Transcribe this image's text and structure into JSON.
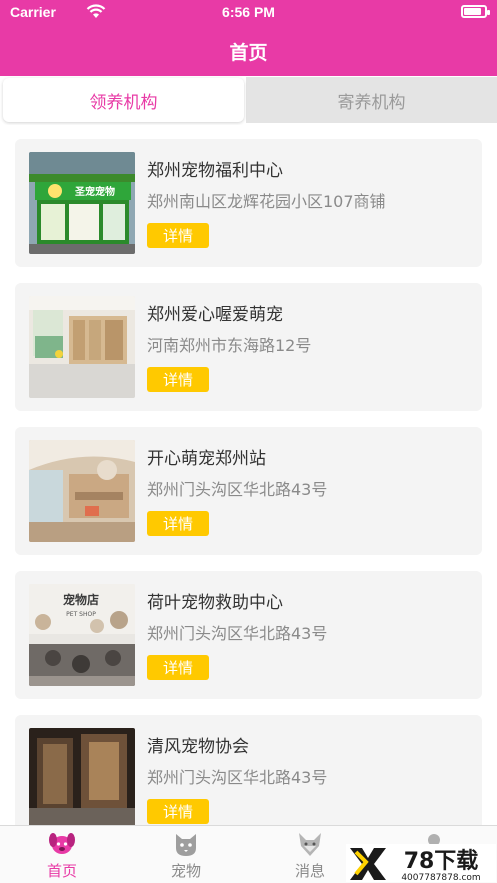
{
  "status_bar": {
    "carrier": "Carrier",
    "time": "6:56 PM",
    "battery_level": 0.85
  },
  "nav": {
    "title": "首页"
  },
  "segments": [
    {
      "label": "领养机构",
      "selected": true
    },
    {
      "label": "寄养机构",
      "selected": false
    }
  ],
  "organizations": [
    {
      "name": "郑州宠物福利中心",
      "address": "郑州南山区龙辉花园小区107商铺",
      "button": "详情",
      "sign_text": "圣宠宠物"
    },
    {
      "name": "郑州爱心喔爱萌宠",
      "address": "河南郑州市东海路12号",
      "button": "详情"
    },
    {
      "name": "开心萌宠郑州站",
      "address": "郑州门头沟区华北路43号",
      "button": "详情"
    },
    {
      "name": "荷叶宠物救助中心",
      "address": "郑州门头沟区华北路43号",
      "button": "详情",
      "sign_text": "宠物店",
      "sign_sub": "PET SHOP"
    },
    {
      "name": "清风宠物协会",
      "address": "郑州门头沟区华北路43号",
      "button": "详情"
    }
  ],
  "tabbar": [
    {
      "label": "首页",
      "icon": "dog-face-icon",
      "active": true
    },
    {
      "label": "宠物",
      "icon": "cat-face-icon",
      "active": false
    },
    {
      "label": "消息",
      "icon": "fox-face-icon",
      "active": false
    },
    {
      "label": "",
      "icon": "profile-icon",
      "active": false
    }
  ],
  "watermark": {
    "brand": "78下载",
    "url": "4007787878.com"
  },
  "colors": {
    "brand_pink": "#e83aa6",
    "button_yellow": "#ffc900",
    "card_bg": "#f4f4f4"
  }
}
